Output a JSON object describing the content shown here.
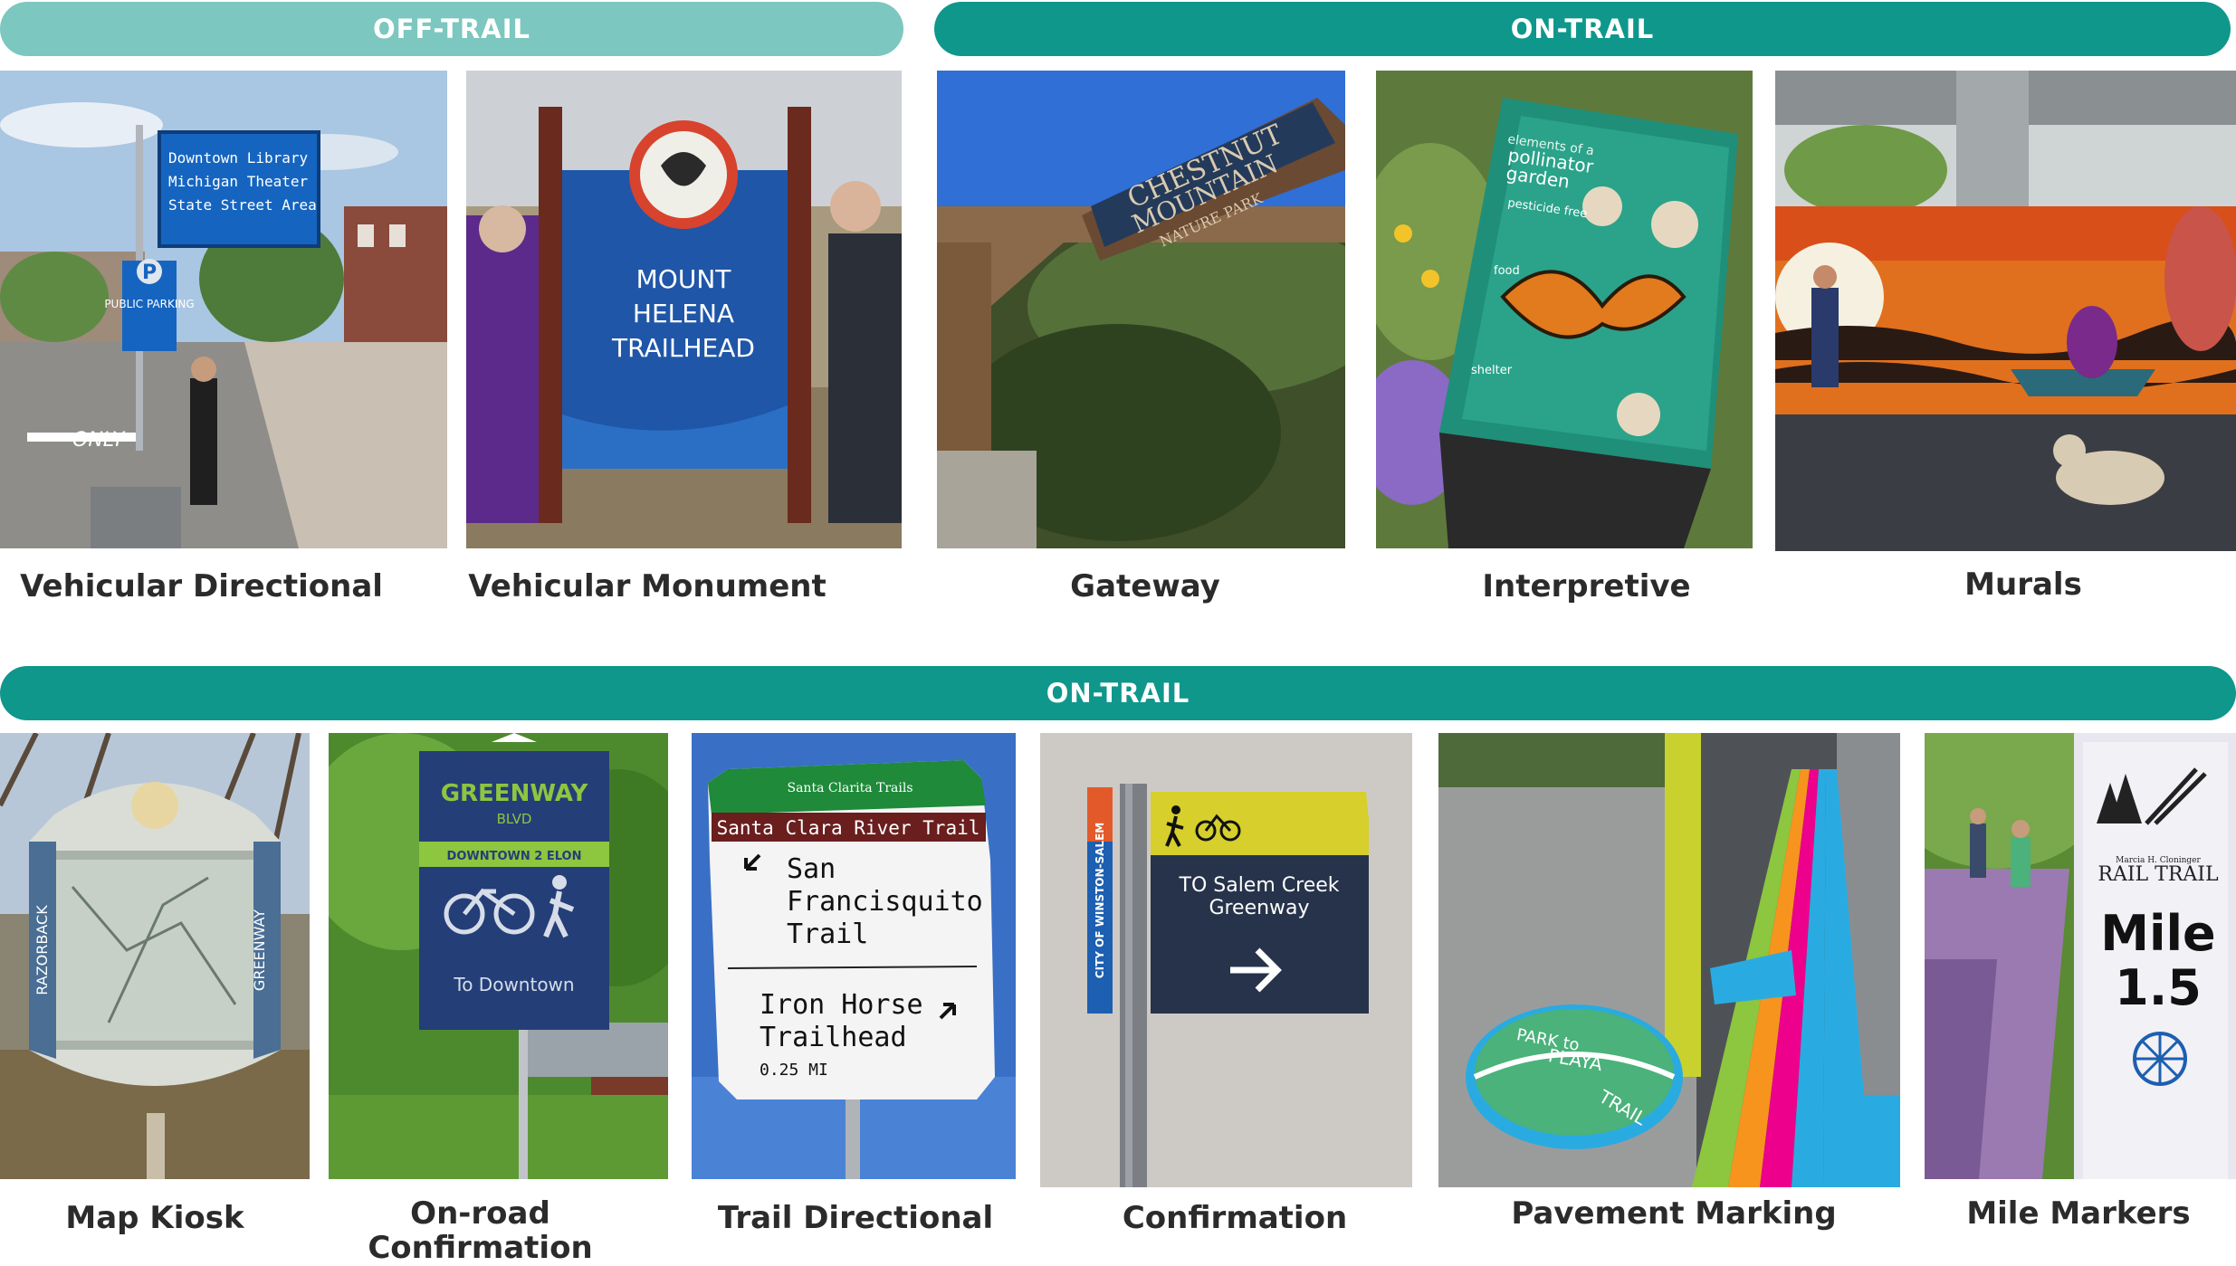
{
  "sections": {
    "off_trail": "OFF-TRAIL",
    "on_trail_top": "ON-TRAIL",
    "on_trail_bottom": "ON-TRAIL"
  },
  "captions": {
    "vehicular_directional": "Vehicular Directional",
    "vehicular_monument": "Vehicular Monument",
    "gateway": "Gateway",
    "interpretive": "Interpretive",
    "murals": "Murals",
    "map_kiosk": "Map Kiosk",
    "on_road_confirmation_line1": "On-road",
    "on_road_confirmation_line2": "Confirmation",
    "trail_directional": "Trail Directional",
    "confirmation": "Confirmation",
    "pavement_marking": "Pavement Marking",
    "mile_markers": "Mile Markers"
  },
  "sign_text": {
    "directional_1": "Downtown Library",
    "directional_2": "Michigan Theater",
    "directional_3": "State Street Area",
    "public_parking": "PUBLIC PARKING",
    "parking_letter": "P",
    "road_only": "ONLY",
    "monument_1": "MOUNT",
    "monument_2": "HELENA",
    "monument_3": "TRAILHEAD",
    "gateway_1": "CHESTNUT",
    "gateway_2": "MOUNTAIN",
    "gateway_3": "NATURE PARK",
    "interp_1": "elements of a",
    "interp_2": "pollinator",
    "interp_3": "garden",
    "interp_4": "pesticide free",
    "interp_5": "food",
    "interp_6": "shelter",
    "kiosk_left": "RAZORBACK",
    "kiosk_right": "GREENWAY",
    "greenway_1": "GREENWAY",
    "greenway_2": "BLVD",
    "greenway_3": "DOWNTOWN 2 ELON",
    "greenway_4": "To Downtown",
    "scrt_1": "Santa Clarita Trails",
    "scrt_2": "Santa Clara River Trail",
    "scrt_3": "San",
    "scrt_4": "Francisquito",
    "scrt_5": "Trail",
    "scrt_6": "Iron Horse",
    "scrt_7": "Trailhead",
    "scrt_8": "0.25 MI",
    "conf_city": "CITY OF WINSTON-SALEM",
    "conf_1": "TO Salem Creek",
    "conf_2": "Greenway",
    "pave_1": "PARK to",
    "pave_2": "PLAYA",
    "pave_3": "TRAIL",
    "mile_1": "Marcia H. Cloninger",
    "mile_2": "RAIL TRAIL",
    "mile_3": "Mile",
    "mile_4": "1.5"
  },
  "colors": {
    "band_light": "#7cc7bf",
    "band_dark": "#0f978c"
  }
}
